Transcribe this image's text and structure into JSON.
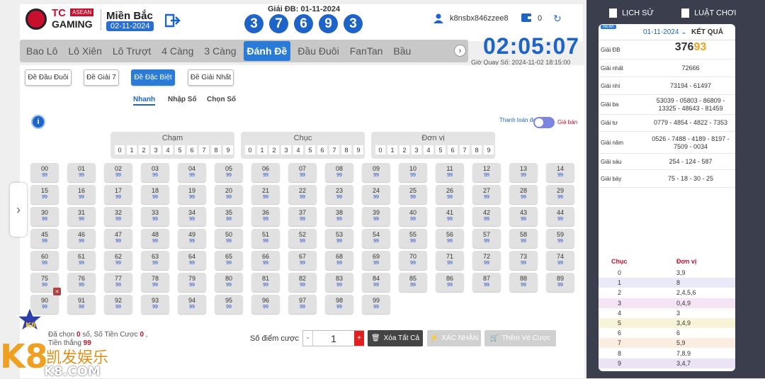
{
  "header": {
    "logo_tc": "TC",
    "logo_asean": "ASEAN",
    "logo_gaming": "GAMING",
    "region": "Miền Bắc",
    "region_date": "02-11-2024",
    "special_prize_label": "Giải ĐB: 01-11-2024",
    "special_digits": [
      "3",
      "7",
      "6",
      "9",
      "3"
    ],
    "username": "k8nsbx846zzee8",
    "balance": "0"
  },
  "tabs": [
    "Bao Lô",
    "Lô Xiên",
    "Lô Trượt",
    "4 Càng",
    "3 Càng",
    "Đánh Đề",
    "Đầu Đuôi",
    "FanTan",
    "Bầu"
  ],
  "active_tab": "Đánh Đề",
  "countdown": "02:05:07",
  "next_draw": "Giờ Quay Số: 2024-11-02 18:15:00",
  "subtabs": [
    "Đề Đầu Đuôi",
    "Đề Giải 7",
    "Đề Đặc Biệt",
    "Đề Giải Nhất"
  ],
  "modes": [
    "Nhanh",
    "Nhập Số",
    "Chọn Số"
  ],
  "toggle": {
    "left": "Thanh toán đơn",
    "right": "Giá bán"
  },
  "digit_groups": [
    {
      "title": "Chạm",
      "digits": [
        "0",
        "1",
        "2",
        "3",
        "4",
        "5",
        "6",
        "7",
        "8",
        "9"
      ]
    },
    {
      "title": "Chục",
      "digits": [
        "0",
        "1",
        "2",
        "3",
        "4",
        "5",
        "6",
        "7",
        "8",
        "9"
      ]
    },
    {
      "title": "Đơn vị",
      "digits": [
        "0",
        "1",
        "2",
        "3",
        "4",
        "5",
        "6",
        "7",
        "8",
        "9"
      ]
    }
  ],
  "odds": "99",
  "summary": {
    "selected_label": "Đã chọn",
    "selected": "0",
    "selected_unit": "số,",
    "stake_label": "Số Tiền Cược",
    "stake": "0",
    "comma": ",",
    "win_label": "Tiền thắng",
    "win": "99"
  },
  "bet": {
    "points_label": "Số điểm cược",
    "minus": "-",
    "qty": "1",
    "plus": "+",
    "clear_all": "Xóa Tất Cả",
    "confirm": "XÁC NHẬN",
    "add_slip": "Thêm Vé Cược"
  },
  "brand": {
    "k8": "K8",
    "cn": "凯发娱乐",
    "com": "K8.COM"
  },
  "right_panel": {
    "history": "LỊCH SỬ",
    "rules": "LUẬT CHƠI",
    "new_badge": "NEW!",
    "date": "01-11-2024",
    "results_title": "KẾT QUẢ",
    "prizes": [
      {
        "label": "Giải ĐB",
        "value": "376",
        "highlight": "93"
      },
      {
        "label": "Giải nhất",
        "value": "72666"
      },
      {
        "label": "Giải nhì",
        "value": "73194 - 61497"
      },
      {
        "label": "Giải ba",
        "value": "53039 - 05803 - 86809 - 13325 - 48643 - 81459"
      },
      {
        "label": "Giải tư",
        "value": "0779 - 4854 - 4822 - 7353"
      },
      {
        "label": "Giải năm",
        "value": "0526 - 7488 - 4189 - 8197 - 7509 - 0034"
      },
      {
        "label": "Giải sáu",
        "value": "254 - 124 - 587"
      },
      {
        "label": "Giải bảy",
        "value": "75 - 18 - 30 - 25"
      }
    ],
    "stats_headers": [
      "Chục",
      "Đơn vị"
    ],
    "stats": [
      {
        "tens": "0",
        "units": "3,9",
        "color": "#ffffff"
      },
      {
        "tens": "1",
        "units": "8",
        "color": "#e8eaf8"
      },
      {
        "tens": "2",
        "units": "2,4,5,6",
        "color": "#ffffff"
      },
      {
        "tens": "3",
        "units": "0,4,9",
        "color": "#f4e4f4"
      },
      {
        "tens": "4",
        "units": "3",
        "color": "#ffffff"
      },
      {
        "tens": "5",
        "units": "3,4,9",
        "color": "#f8f4d8"
      },
      {
        "tens": "6",
        "units": "6",
        "color": "#ffffff"
      },
      {
        "tens": "7",
        "units": "5,9",
        "color": "#fbeee0"
      },
      {
        "tens": "8",
        "units": "7,8,9",
        "color": "#ffffff"
      },
      {
        "tens": "9",
        "units": "3,4,7",
        "color": "#ece4f4"
      }
    ]
  }
}
